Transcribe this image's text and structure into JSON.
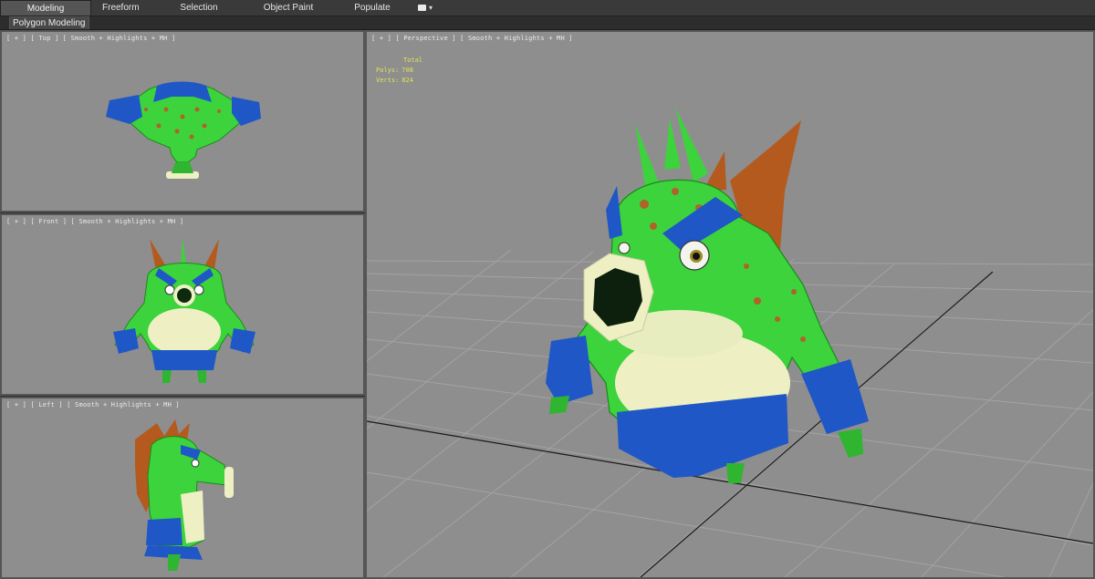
{
  "ribbon": {
    "tabs": [
      {
        "label": "Modeling",
        "active": true
      },
      {
        "label": "Freeform",
        "active": false
      },
      {
        "label": "Selection",
        "active": false
      },
      {
        "label": "Object Paint",
        "active": false
      },
      {
        "label": "Populate",
        "active": false
      }
    ],
    "extra_icon": "toggle-box-icon",
    "extra_dropdown": "▾"
  },
  "subbar": {
    "active_panel": "Polygon Modeling"
  },
  "viewports": {
    "top": {
      "label": "[ + ] [ Top ] [ Smooth + Highlights + MH ]"
    },
    "front": {
      "label": "[ + ] [ Front ] [ Smooth + Highlights + MH ]"
    },
    "left": {
      "label": "[ + ] [ Left ] [ Smooth + Highlights + MH ]"
    },
    "perspective": {
      "label": "[ + ] [ Perspective ] [ Smooth + Highlights + MH ]",
      "stats": {
        "header": "Total",
        "polys_label": "Polys:",
        "polys": "708",
        "verts_label": "Verts:",
        "verts": "824"
      }
    }
  },
  "colors": {
    "viewport_bg": "#8e8e8e",
    "grid": "#a3a3a3",
    "active_border": "#555555",
    "stats_text": "#e3e356",
    "model_green": "#3dd33c",
    "model_blue": "#1f57c7",
    "model_orange": "#b45a1e",
    "model_cream": "#eef0c4"
  }
}
